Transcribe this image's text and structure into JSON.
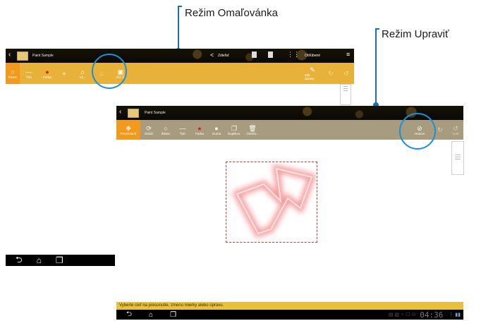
{
  "callouts": {
    "paint_mode": "Režim Omaľovánka",
    "edit_mode": "Režim Upraviť"
  },
  "top_screen": {
    "app_title": "Paint Sample",
    "actions": {
      "share": "Zdieľať",
      "favorites": "Obľúbené"
    },
    "tools": [
      "Štetec",
      "Ťah",
      "Farba",
      "",
      "Vý...",
      "",
      "Zst. rl."
    ],
    "right_tool": "Zak. úpravy"
  },
  "edit_screen": {
    "app_title": "Paint Sample",
    "tools": [
      "Premiestniť",
      "Otočiť",
      "Štetec",
      "Ťah",
      "Farba",
      "Guma",
      "Duplikov.",
      "Odstrá..."
    ],
    "done": "Hotovo",
    "undo": "Späť"
  },
  "status": {
    "hint": "Vyberte cieľ na presunutie, zmenu mierky alebo úpravu.",
    "clock": "04:36"
  },
  "colors": {
    "accent": "#e8b23a",
    "edit_toolbar": "#a79c80",
    "callout": "#1b8fd8"
  }
}
